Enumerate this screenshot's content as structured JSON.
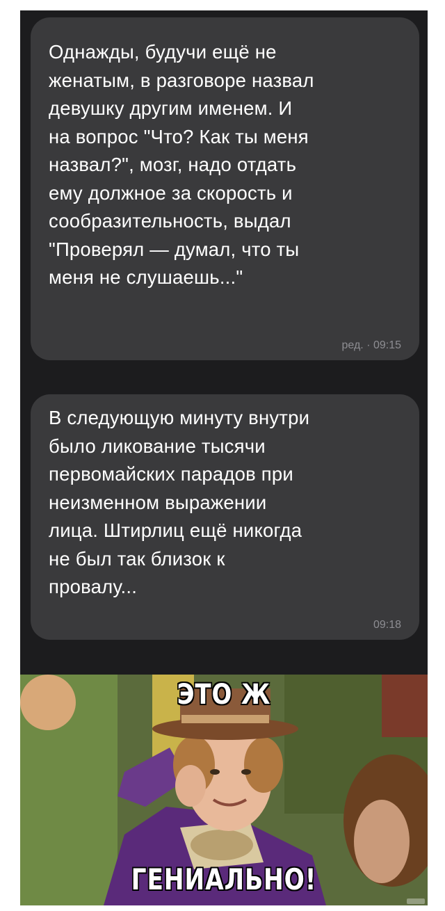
{
  "messages": [
    {
      "text": "Однажды, будучи ещё не\nженатым, в разговоре назвал\nдевушку другим именем. И\nна вопрос \"Что? Как ты меня\nназвал?\", мозг, надо отдать\nему должное за скорость и\nсообразительность, выдал\n\"Проверял — думал, что ты\nменя не слушаешь...\"",
      "time": "ред. · 09:15"
    },
    {
      "text": "В следующую минуту внутри\nбыло ликование тысячи\nпервомайских парадов при\nнеизменном выражении\nлица. Штирлиц ещё никогда\nне был так близок к\nпровалу...",
      "time": "09:18"
    }
  ],
  "meme": {
    "top_text": "ЭТО Ж",
    "bottom_text": "ГЕНИАЛЬНО!"
  }
}
